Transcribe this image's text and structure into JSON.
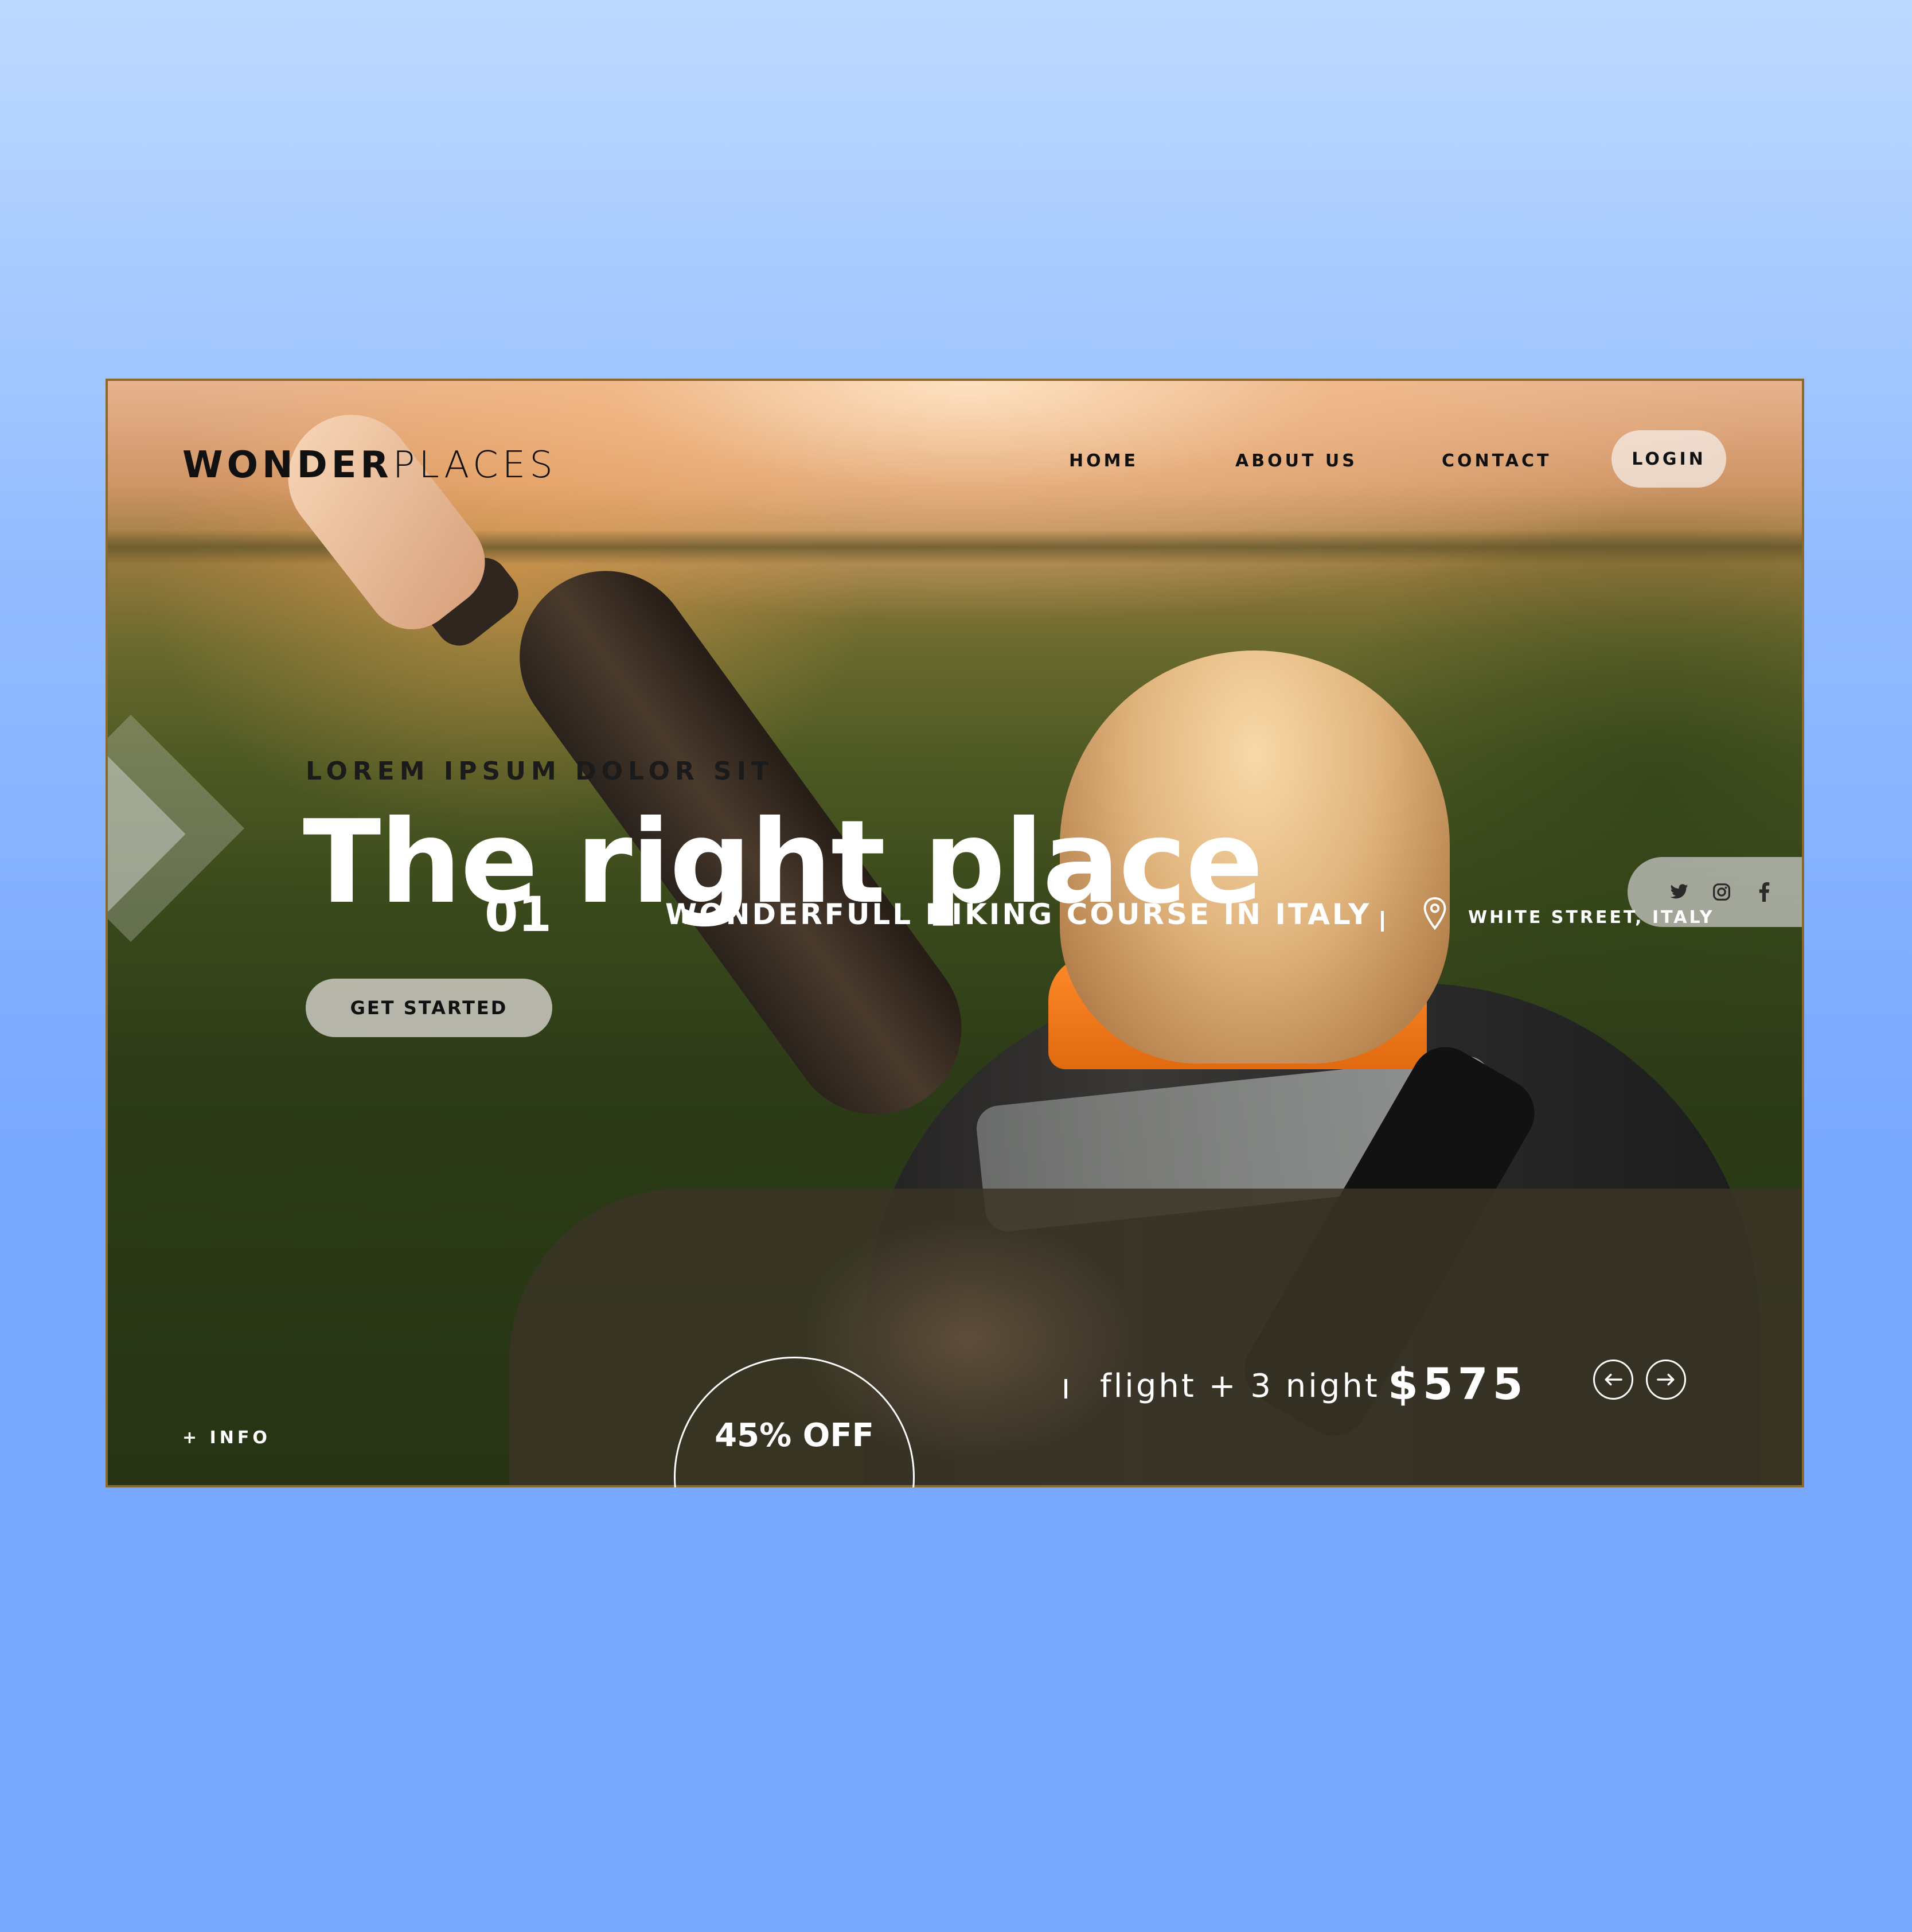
{
  "brand": {
    "bold": "WONDER",
    "light": "PLACES"
  },
  "nav": {
    "home": "HOME",
    "about": "ABOUT US",
    "contact": "CONTACT",
    "login": "LOGIN"
  },
  "hero": {
    "eyebrow": "LOREM IPSUM DOLOR SIT",
    "title": "The right place",
    "cta": "GET STARTED"
  },
  "social": [
    "twitter-icon",
    "instagram-icon",
    "facebook-icon"
  ],
  "info_link": "+ INFO",
  "offer": {
    "index": "01",
    "title": "WONDERFULL HIKING COURSE IN ITALY",
    "location": "WHITE STREET, ITALY",
    "package": "flight + 3 night",
    "price": "$575",
    "discount": "45% OFF"
  },
  "colors": {
    "accent_orange": "#f07a1c",
    "panel": "#3a3426",
    "text_dark": "#111111"
  }
}
